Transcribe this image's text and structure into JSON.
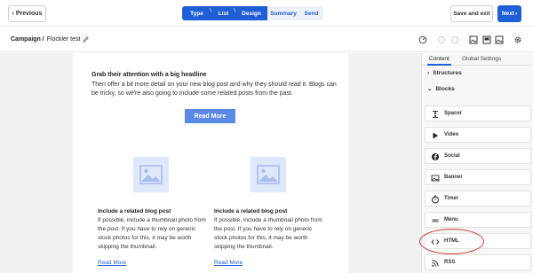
{
  "topbar": {
    "previous_label": "Previous",
    "steps": [
      {
        "label": "Type",
        "active": true
      },
      {
        "label": "List",
        "active": true
      },
      {
        "label": "Design",
        "active": true
      },
      {
        "label": "Summary",
        "active": false
      },
      {
        "label": "Send",
        "active": false
      }
    ],
    "save_exit_label": "Save and exit",
    "next_label": "Next"
  },
  "subbar": {
    "breadcrumb_root": "Campaign /",
    "campaign_name": "Flockler test",
    "tools": [
      "gauge-icon",
      "undo-icon",
      "redo-icon",
      "image-icon",
      "preview-icon",
      "image-icon",
      "gear-icon"
    ]
  },
  "email": {
    "headline": "Grab their attention with a big headline",
    "lead": "Then offer a bit more detail on your new blog post and why they should read it. Blogs can be tricky, so we're also going to include some related posts from the past.",
    "read_more_button": "Read More",
    "columns": [
      {
        "title": "Include a related blog post",
        "body": "If possible, include a thumbnail photo from the post. If you have to rely on generic stock photos for this, it may be worth skipping the thumbnail.",
        "link": "Read More"
      },
      {
        "title": "Include a related blog post",
        "body": "If possible, include a thumbnail photo from the post. If you have to rely on generic stock photos for this, it may be worth skipping the thumbnail.",
        "link": "Read More"
      }
    ]
  },
  "panel": {
    "tabs": [
      "Content",
      "Global Settings"
    ],
    "structures_label": "Structures",
    "blocks_label": "Blocks",
    "blocks": [
      {
        "label": "Spacer",
        "icon": "spacer-icon"
      },
      {
        "label": "Video",
        "icon": "play-icon"
      },
      {
        "label": "Social",
        "icon": "social-icon"
      },
      {
        "label": "Banner",
        "icon": "banner-icon"
      },
      {
        "label": "Timer",
        "icon": "timer-icon"
      },
      {
        "label": "Menu",
        "icon": "menu-icon"
      },
      {
        "label": "HTML",
        "icon": "code-icon"
      },
      {
        "label": "RSS",
        "icon": "rss-icon"
      }
    ]
  },
  "colors": {
    "accent": "#1f5fd6",
    "button_light": "#5b8ae6",
    "highlight_circle": "#d23b2f"
  }
}
